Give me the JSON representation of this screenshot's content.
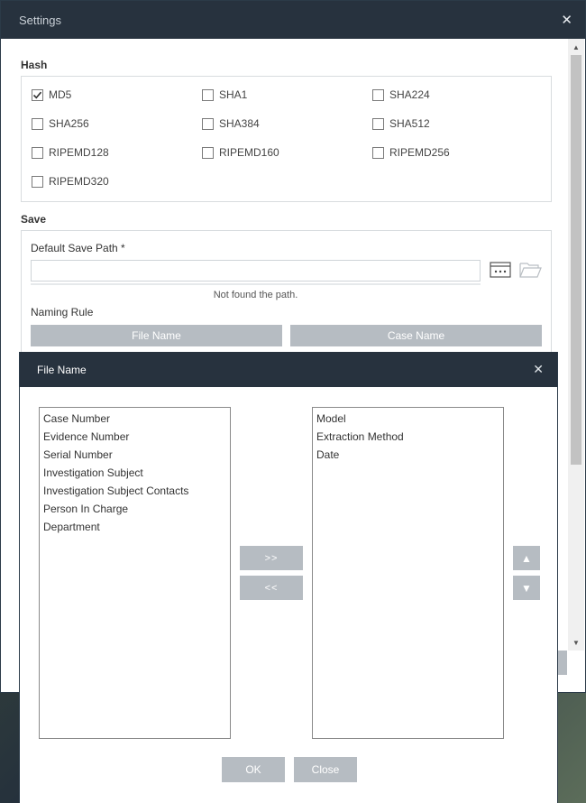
{
  "settings": {
    "title": "Settings",
    "close_glyph": "✕",
    "hash": {
      "title": "Hash",
      "options": [
        {
          "label": "MD5",
          "checked": true
        },
        {
          "label": "SHA1",
          "checked": false
        },
        {
          "label": "SHA224",
          "checked": false
        },
        {
          "label": "SHA256",
          "checked": false
        },
        {
          "label": "SHA384",
          "checked": false
        },
        {
          "label": "SHA512",
          "checked": false
        },
        {
          "label": "RIPEMD128",
          "checked": false
        },
        {
          "label": "RIPEMD160",
          "checked": false
        },
        {
          "label": "RIPEMD256",
          "checked": false
        },
        {
          "label": "RIPEMD320",
          "checked": false
        }
      ]
    },
    "save": {
      "title": "Save",
      "default_path_label": "Default Save Path *",
      "default_path_value": "",
      "not_found": "Not found the path.",
      "naming_rule_label": "Naming Rule",
      "file_name_button": "File Name",
      "case_name_button": "Case Name"
    }
  },
  "file_name_dialog": {
    "title": "File Name",
    "close_glyph": "✕",
    "available_fields": [
      "Case Number",
      "Evidence Number",
      "Serial Number",
      "Investigation Subject",
      "Investigation Subject Contacts",
      "Person In Charge",
      "Department"
    ],
    "selected_fields": [
      "Model",
      "Extraction Method",
      "Date"
    ],
    "add_button": ">>",
    "remove_button": "<<",
    "move_up_glyph": "▲",
    "move_down_glyph": "▼",
    "ok_button": "OK",
    "close_button": "Close"
  },
  "colors": {
    "titlebar": "#27323e",
    "button": "#b6bcc2",
    "border": "#d8dcdf"
  },
  "icons": [
    "check-icon",
    "browse-icon",
    "folder-icon",
    "close-icon",
    "arrow-up-icon",
    "arrow-down-icon"
  ]
}
